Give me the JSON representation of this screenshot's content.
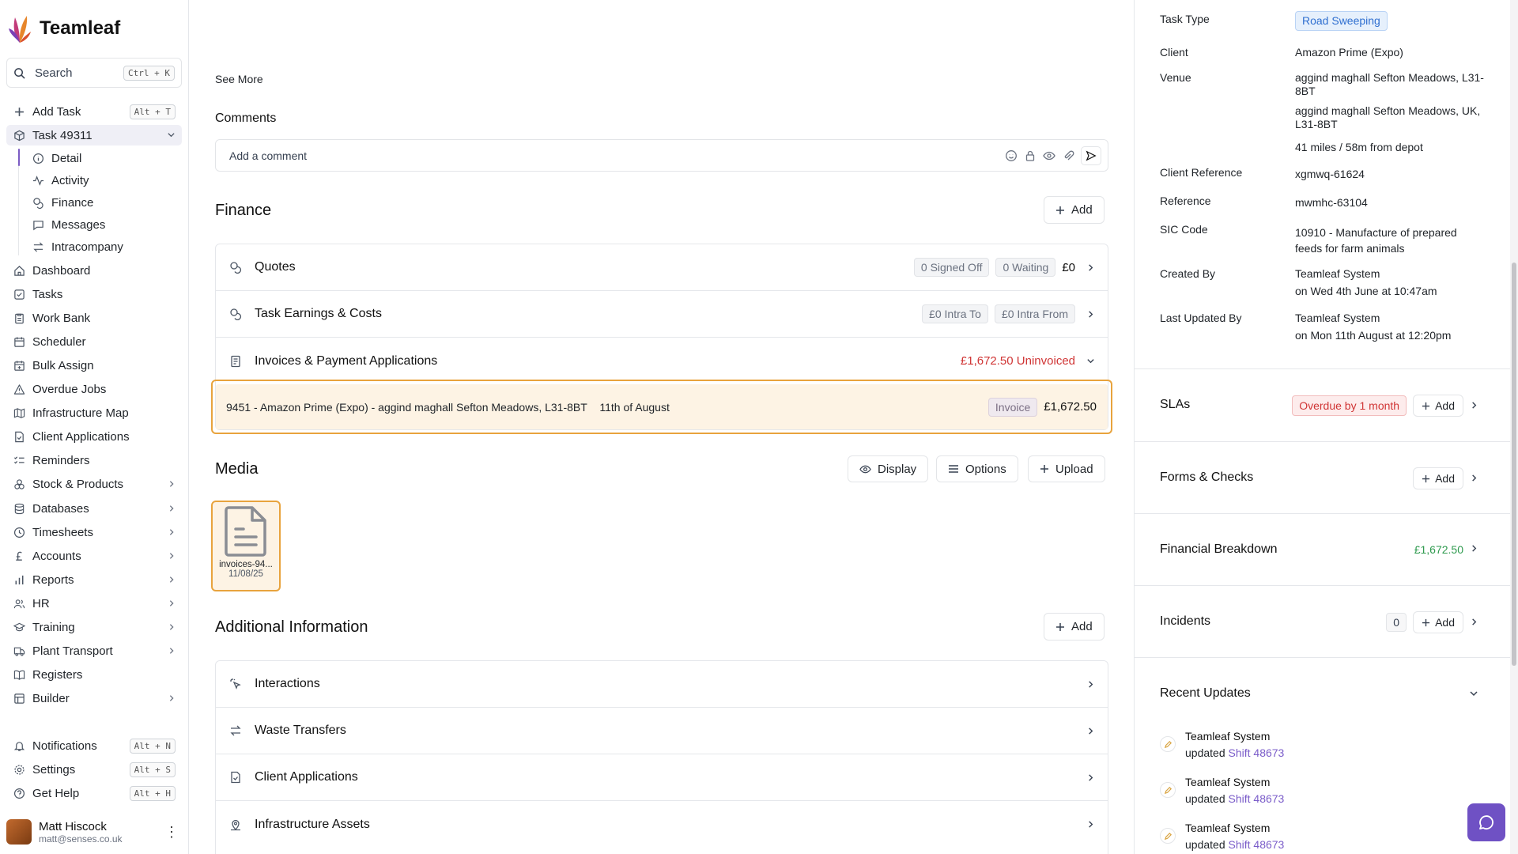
{
  "app": {
    "name": "Teamleaf"
  },
  "search": {
    "label": "Search",
    "shortcut": "Ctrl + K"
  },
  "sidebar": {
    "add_task": {
      "label": "Add Task",
      "shortcut": "Alt + T"
    },
    "current_task": {
      "label": "Task 49311"
    },
    "task_sub": [
      {
        "label": "Detail",
        "icon": "info-icon"
      },
      {
        "label": "Activity",
        "icon": "activity-icon"
      },
      {
        "label": "Finance",
        "icon": "coins-icon"
      },
      {
        "label": "Messages",
        "icon": "message-icon"
      },
      {
        "label": "Intracompany",
        "icon": "arrows-swap-icon"
      }
    ],
    "items": [
      {
        "label": "Dashboard",
        "icon": "home-icon"
      },
      {
        "label": "Tasks",
        "icon": "checkbox-icon"
      },
      {
        "label": "Work Bank",
        "icon": "clipboard-icon"
      },
      {
        "label": "Scheduler",
        "icon": "calendar-icon"
      },
      {
        "label": "Bulk Assign",
        "icon": "calendar-plus-icon"
      },
      {
        "label": "Overdue Jobs",
        "icon": "warning-icon"
      },
      {
        "label": "Infrastructure Map",
        "icon": "map-icon"
      },
      {
        "label": "Client Applications",
        "icon": "file-check-icon"
      },
      {
        "label": "Reminders",
        "icon": "list-check-icon"
      },
      {
        "label": "Stock & Products",
        "icon": "boxes-icon"
      },
      {
        "label": "Databases",
        "icon": "database-icon"
      },
      {
        "label": "Timesheets",
        "icon": "clock-icon"
      },
      {
        "label": "Accounts",
        "icon": "pound-icon"
      },
      {
        "label": "Reports",
        "icon": "bar-chart-icon"
      },
      {
        "label": "HR",
        "icon": "users-icon"
      },
      {
        "label": "Training",
        "icon": "graduation-cap-icon"
      },
      {
        "label": "Plant Transport",
        "icon": "truck-icon"
      },
      {
        "label": "Registers",
        "icon": "book-icon"
      },
      {
        "label": "Builder",
        "icon": "layout-icon"
      }
    ],
    "bottom": [
      {
        "label": "Notifications",
        "shortcut": "Alt + N",
        "icon": "bell-icon"
      },
      {
        "label": "Settings",
        "shortcut": "Alt + S",
        "icon": "gear-icon"
      },
      {
        "label": "Get Help",
        "shortcut": "Alt + H",
        "icon": "help-icon"
      }
    ],
    "user": {
      "name": "Matt Hiscock",
      "email": "matt@senses.co.uk"
    }
  },
  "main": {
    "see_more": "See More",
    "comments": {
      "title": "Comments",
      "placeholder": "Add a comment"
    },
    "finance": {
      "title": "Finance",
      "add_label": "Add",
      "quotes": {
        "label": "Quotes",
        "signed_off": "0 Signed Off",
        "waiting": "0 Waiting",
        "amount": "£0"
      },
      "earnings": {
        "label": "Task Earnings & Costs",
        "intra_to": "£0 Intra To",
        "intra_from": "£0 Intra From"
      },
      "invoices": {
        "label": "Invoices & Payment Applications",
        "uninvoiced": "£1,672.50 Uninvoiced"
      },
      "invoice_row": {
        "description": "9451 - Amazon Prime (Expo) - aggind maghall Sefton Meadows, L31-8BT",
        "date": "11th of August",
        "type": "Invoice",
        "amount": "£1,672.50"
      }
    },
    "media": {
      "title": "Media",
      "display_label": "Display",
      "options_label": "Options",
      "upload_label": "Upload",
      "file": {
        "name": "invoices-94...",
        "date": "11/08/25"
      }
    },
    "additional": {
      "title": "Additional Information",
      "add_label": "Add",
      "rows": [
        {
          "label": "Interactions"
        },
        {
          "label": "Waste Transfers"
        },
        {
          "label": "Client Applications"
        },
        {
          "label": "Infrastructure Assets"
        }
      ]
    }
  },
  "details": {
    "task_type": {
      "label": "Task Type",
      "value": "Road Sweeping"
    },
    "client": {
      "label": "Client",
      "value": "Amazon Prime (Expo)"
    },
    "venue": {
      "label": "Venue",
      "line1": "aggind maghall Sefton Meadows, L31-8BT",
      "line2": "aggind maghall Sefton Meadows, UK, L31-8BT",
      "distance": "41 miles / 58m from depot"
    },
    "client_reference": {
      "label": "Client Reference",
      "value": "xgmwq-61624"
    },
    "reference": {
      "label": "Reference",
      "value": "mwmhc-63104"
    },
    "sic_code": {
      "label": "SIC Code",
      "value": "10910 - Manufacture of prepared feeds for farm animals"
    },
    "created_by": {
      "label": "Created By",
      "name": "Teamleaf System",
      "when": "on Wed 4th June at 10:47am"
    },
    "last_updated_by": {
      "label": "Last Updated By",
      "name": "Teamleaf System",
      "when": "on Mon 11th August at 12:20pm"
    }
  },
  "right_sections": {
    "slas": {
      "title": "SLAs",
      "status": "Overdue by 1 month",
      "add_label": "Add"
    },
    "forms": {
      "title": "Forms & Checks",
      "add_label": "Add"
    },
    "financial": {
      "title": "Financial Breakdown",
      "amount": "£1,672.50"
    },
    "incidents": {
      "title": "Incidents",
      "count": "0",
      "add_label": "Add"
    },
    "recent": {
      "title": "Recent Updates",
      "items": [
        {
          "who": "Teamleaf System",
          "action": "updated",
          "target": "Shift 48673"
        },
        {
          "who": "Teamleaf System",
          "action": "updated",
          "target": "Shift 48673"
        },
        {
          "who": "Teamleaf System",
          "action": "updated",
          "target": "Shift 48673"
        }
      ]
    }
  },
  "colors": {
    "accent": "#6f51c4",
    "highlight_border": "#e8a33d",
    "highlight_bg": "#fdf3e4",
    "danger": "#d03535",
    "success": "#2e9a4e"
  }
}
